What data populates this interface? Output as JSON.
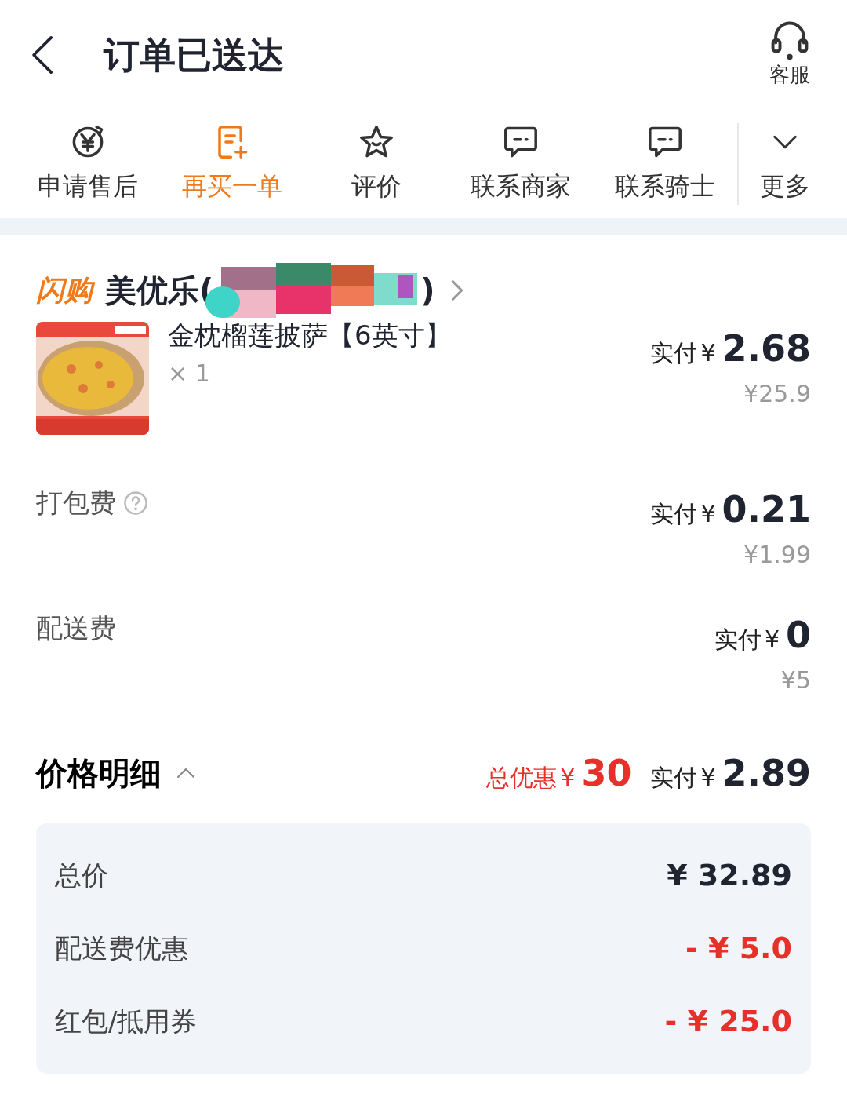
{
  "header": {
    "title": "订单已送达",
    "service_label": "客服"
  },
  "actions": [
    {
      "label": "申请售后",
      "kind": "refund",
      "highlighted": false
    },
    {
      "label": "再买一单",
      "kind": "reorder",
      "highlighted": true
    },
    {
      "label": "评价",
      "kind": "review",
      "highlighted": false
    },
    {
      "label": "联系商家",
      "kind": "chat",
      "highlighted": false
    },
    {
      "label": "联系骑士",
      "kind": "chat",
      "highlighted": false
    }
  ],
  "more": {
    "label": "更多"
  },
  "shop": {
    "tag": "闪购",
    "name_start": "美优乐(",
    "name_end": ")"
  },
  "item": {
    "name": "金枕榴莲披萨【6英寸】",
    "quantity": "× 1",
    "paid_label": "实付",
    "currency": "¥",
    "paid": "2.68",
    "original": "¥25.9"
  },
  "fees": [
    {
      "label": "打包费",
      "has_help": true,
      "paid_label": "实付",
      "currency": "¥",
      "paid": "0.21",
      "original": "¥1.99"
    },
    {
      "label": "配送费",
      "has_help": false,
      "paid_label": "实付",
      "currency": "¥",
      "paid": "0",
      "original": "¥5"
    }
  ],
  "summary": {
    "title": "价格明细",
    "expanded": true,
    "discount_label": "总优惠",
    "discount_currency": "¥",
    "discount": "30",
    "paid_label": "实付",
    "paid_currency": "¥",
    "paid": "2.89"
  },
  "breakdown": [
    {
      "label": "总价",
      "value": "¥ 32.89",
      "kind": "total"
    },
    {
      "label": "配送费优惠",
      "value": "- ¥ 5.0",
      "kind": "discount"
    },
    {
      "label": "红包/抵用券",
      "value": "- ¥ 25.0",
      "kind": "discount"
    }
  ]
}
